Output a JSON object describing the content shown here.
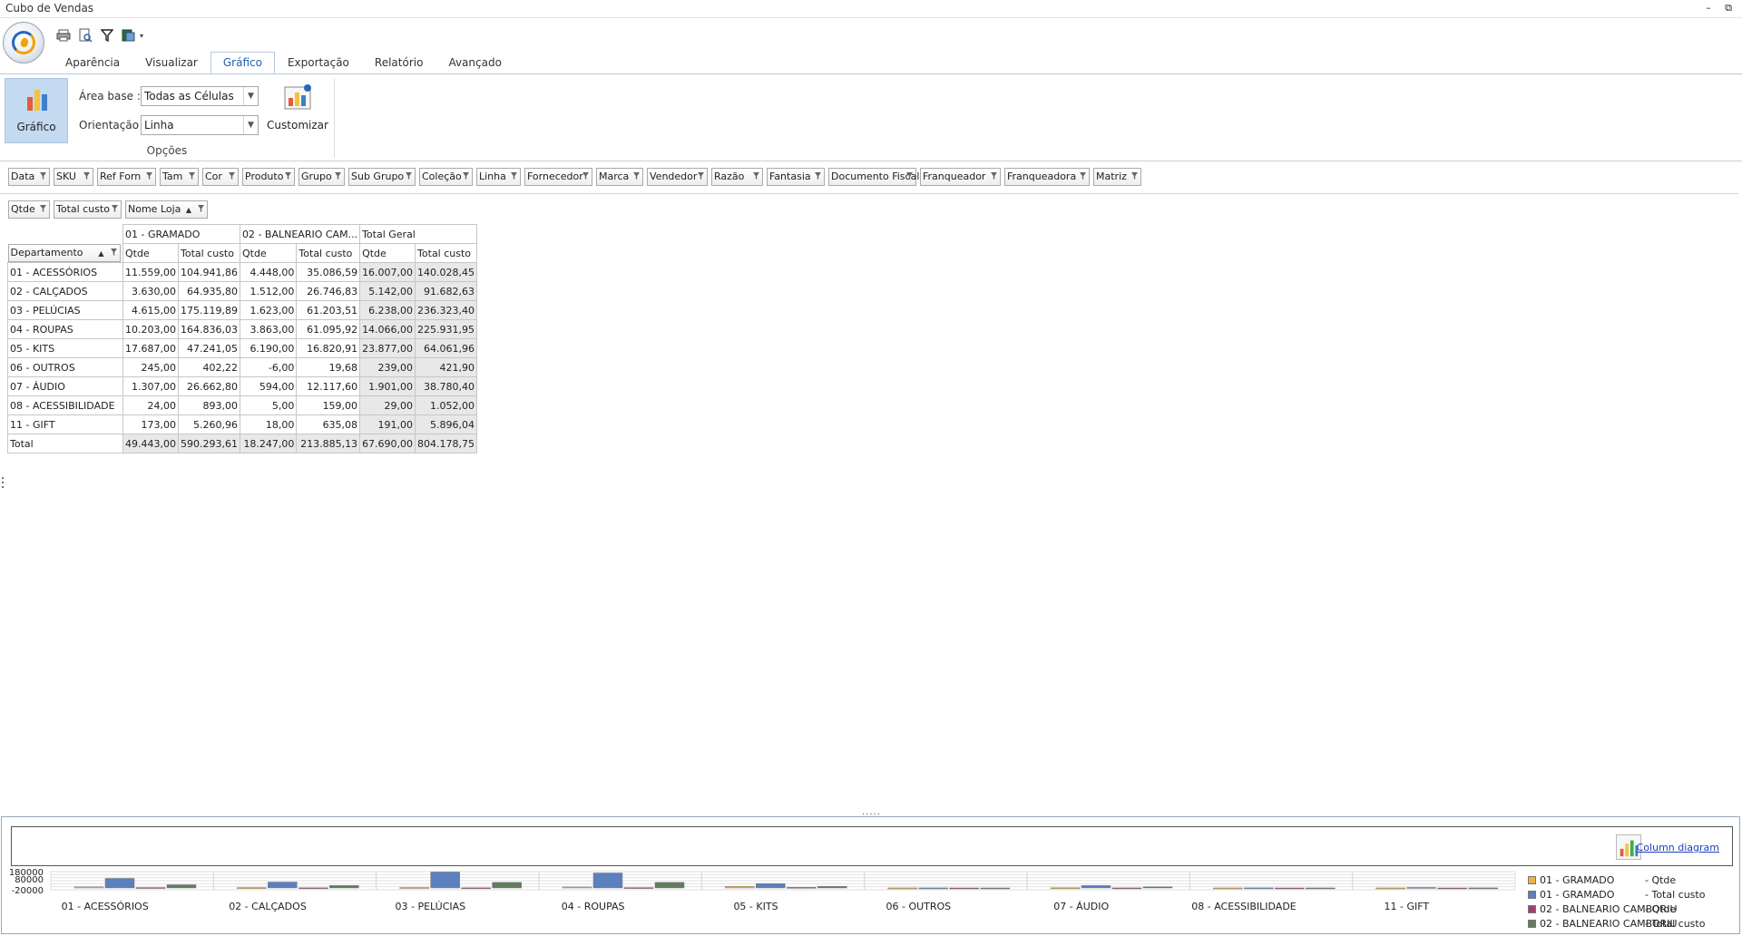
{
  "window": {
    "title": "Cubo de Vendas",
    "minimize": "–",
    "restore": "⧉"
  },
  "tabs": [
    "Aparência",
    "Visualizar",
    "Gráfico",
    "Exportação",
    "Relatório",
    "Avançado"
  ],
  "active_tab": "Gráfico",
  "ribbon": {
    "grafico_button": "Gráfico",
    "area_base_label": "Área base  :",
    "area_base_value": "Todas as Células",
    "orientacao_label": "Orientação :",
    "orientacao_value": "Linha",
    "customizar_button": "Customizar",
    "group_label": "Opções"
  },
  "filter_fields": [
    "Data",
    "SKU",
    "Ref Forn",
    "Tam",
    "Cor",
    "Produto",
    "Grupo",
    "Sub Grupo",
    "Coleção",
    "Linha",
    "Fornecedor",
    "Marca",
    "Vendedor",
    "Razão",
    "Fantasia",
    "Documento Fiscal",
    "Franqueador",
    "Franqueadora",
    "Matriz"
  ],
  "data_fields": [
    "Qtde",
    "Total custo"
  ],
  "column_field": "Nome Loja",
  "row_field": "Departamento",
  "pivot": {
    "column_groups": [
      "01 - GRAMADO",
      "02 - BALNEARIO CAM...",
      "Total Geral"
    ],
    "measures": [
      "Qtde",
      "Total custo",
      "Qtde",
      "Total custo",
      "Qtde",
      "Total custo"
    ],
    "rows": [
      {
        "label": "01 - ACESSÓRIOS",
        "values": [
          "11.559,00",
          "104.941,86",
          "4.448,00",
          "35.086,59",
          "16.007,00",
          "140.028,45"
        ]
      },
      {
        "label": "02 - CALÇADOS",
        "values": [
          "3.630,00",
          "64.935,80",
          "1.512,00",
          "26.746,83",
          "5.142,00",
          "91.682,63"
        ]
      },
      {
        "label": "03 - PELÚCIAS",
        "values": [
          "4.615,00",
          "175.119,89",
          "1.623,00",
          "61.203,51",
          "6.238,00",
          "236.323,40"
        ]
      },
      {
        "label": "04 - ROUPAS",
        "values": [
          "10.203,00",
          "164.836,03",
          "3.863,00",
          "61.095,92",
          "14.066,00",
          "225.931,95"
        ]
      },
      {
        "label": "05 - KITS",
        "values": [
          "17.687,00",
          "47.241,05",
          "6.190,00",
          "16.820,91",
          "23.877,00",
          "64.061,96"
        ]
      },
      {
        "label": "06 - OUTROS",
        "values": [
          "245,00",
          "402,22",
          "-6,00",
          "19,68",
          "239,00",
          "421,90"
        ]
      },
      {
        "label": "07 - ÁUDIO",
        "values": [
          "1.307,00",
          "26.662,80",
          "594,00",
          "12.117,60",
          "1.901,00",
          "38.780,40"
        ]
      },
      {
        "label": "08 - ACESSIBILIDADE",
        "values": [
          "24,00",
          "893,00",
          "5,00",
          "159,00",
          "29,00",
          "1.052,00"
        ]
      },
      {
        "label": "11 - GIFT",
        "values": [
          "173,00",
          "5.260,96",
          "18,00",
          "635,08",
          "191,00",
          "5.896,04"
        ]
      }
    ],
    "total": {
      "label": "Total",
      "values": [
        "49.443,00",
        "590.293,61",
        "18.247,00",
        "213.885,13",
        "67.690,00",
        "804.178,75"
      ]
    }
  },
  "splitter": ".....",
  "chart_link": "Column diagram",
  "chart_data": {
    "type": "bar",
    "categories": [
      "01 - ACESSÓRIOS",
      "02 - CALÇADOS",
      "03 - PELÚCIAS",
      "04 - ROUPAS",
      "05 - KITS",
      "06 - OUTROS",
      "07 - ÁUDIO",
      "08 - ACESSIBILIDADE",
      "11 - GIFT"
    ],
    "ylim": [
      -20000,
      180000
    ],
    "yticks": [
      "180000",
      "80000",
      "-20000"
    ],
    "series": [
      {
        "name": "01 - GRAMADO",
        "measure": "- Qtde",
        "color": "#f0b042",
        "values": [
          11559,
          3630,
          4615,
          10203,
          17687,
          245,
          1307,
          24,
          173
        ]
      },
      {
        "name": "01 - GRAMADO",
        "measure": "- Total custo",
        "color": "#5b7fbf",
        "values": [
          104941.86,
          64935.8,
          175119.89,
          164836.03,
          47241.05,
          402.22,
          26662.8,
          893.0,
          5260.96
        ]
      },
      {
        "name": "02 - BALNEARIO CAMBORIU",
        "measure": "- Qtde",
        "color": "#a0406a",
        "values": [
          4448,
          1512,
          1623,
          3863,
          6190,
          -6,
          594,
          5,
          18
        ]
      },
      {
        "name": "02 - BALNEARIO CAMBORIU",
        "measure": "- Total custo",
        "color": "#637a5c",
        "values": [
          35086.59,
          26746.83,
          61203.51,
          61095.92,
          16820.91,
          19.68,
          12117.6,
          159.0,
          635.08
        ]
      }
    ]
  }
}
